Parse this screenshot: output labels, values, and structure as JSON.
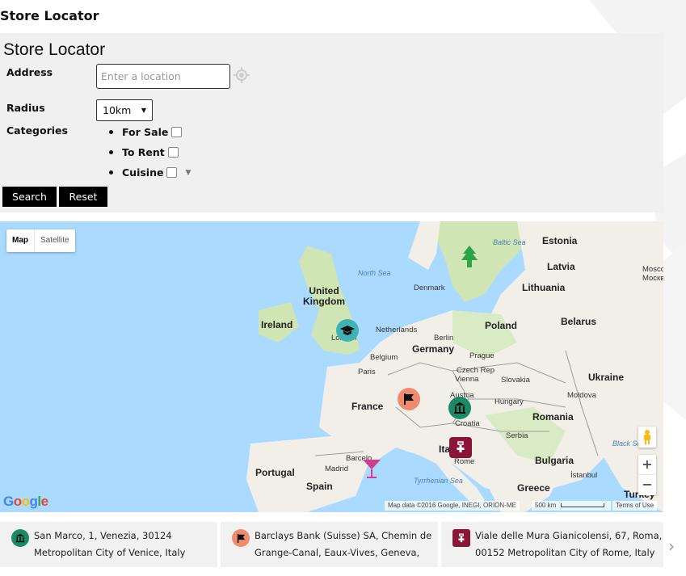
{
  "page": {
    "heading": "Store Locator"
  },
  "form": {
    "title": "Store Locator",
    "address_label": "Address",
    "address_placeholder": "Enter a location",
    "radius_label": "Radius",
    "radius_value": "10km",
    "categories_label": "Categories",
    "categories": [
      {
        "label": "For Sale",
        "checked": false
      },
      {
        "label": "To Rent",
        "checked": false
      },
      {
        "label": "Cuisine",
        "checked": false
      }
    ],
    "search_label": "Search",
    "reset_label": "Reset"
  },
  "map": {
    "type_map": "Map",
    "type_satellite": "Satellite",
    "zoom_in": "+",
    "zoom_out": "−",
    "google": "Google",
    "attribution": "Map data ©2016 Google, INEGI, ORION-ME",
    "scale": "500 km",
    "terms": "Terms of Use",
    "labels": {
      "baltic_sea": "Baltic Sea",
      "north_sea": "North Sea",
      "estonia": "Estonia",
      "latvia": "Latvia",
      "moscow": "Mosco\nМоскв",
      "lithuania": "Lithuania",
      "denmark": "Denmark",
      "united_kingdom": "United\nKingdom",
      "ireland": "Ireland",
      "london": "London",
      "netherlands": "Netherlands",
      "berlin": "Berlin",
      "poland": "Poland",
      "belarus": "Belarus",
      "belgium": "Belgium",
      "germany": "Germany",
      "prague": "Prague",
      "czech": "Czech Rep",
      "paris": "Paris",
      "vienna": "Vienna",
      "slovakia": "Slovakia",
      "ukraine": "Ukraine",
      "austria": "Austria",
      "moldova": "Moldova",
      "france": "France",
      "hungary": "Hungary",
      "croatia": "Croatia",
      "romania": "Romania",
      "serbia": "Serbia",
      "black_sea": "Black Se",
      "italy": "Ita",
      "rome": "Rome",
      "bulgaria": "Bulgaria",
      "portugal": "Portugal",
      "madrid": "Madrid",
      "barcelona": "Barcelo",
      "spain": "Spain",
      "tyrrhenian": "Tyrrhenian Sea",
      "greece": "Greece",
      "istanbul": "İstanbul",
      "turkey": "Turkey"
    },
    "colors": {
      "water": "#aadaff",
      "land": "#f2efe9",
      "green": "#cfe5b4",
      "border": "#9c9c9c"
    }
  },
  "results": [
    {
      "line1": "San Marco, 1, Venezia, 30124",
      "line2": "Metropolitan City of Venice, Italy",
      "icon": "bank-icon",
      "color": "#1a8a66"
    },
    {
      "line1": "Barclays Bank (Suisse) SA, Chemin de",
      "line2": "Grange-Canal, Eaux-Vives, Geneva,",
      "icon": "flag-icon",
      "color": "#ef8c6e"
    },
    {
      "line1": "Viale delle Mura Gianicolensi, 67, Roma,",
      "line2": "00152 Metropolitan City of Rome, Italy",
      "icon": "medical-kit-icon",
      "color": "#8a1538"
    }
  ]
}
